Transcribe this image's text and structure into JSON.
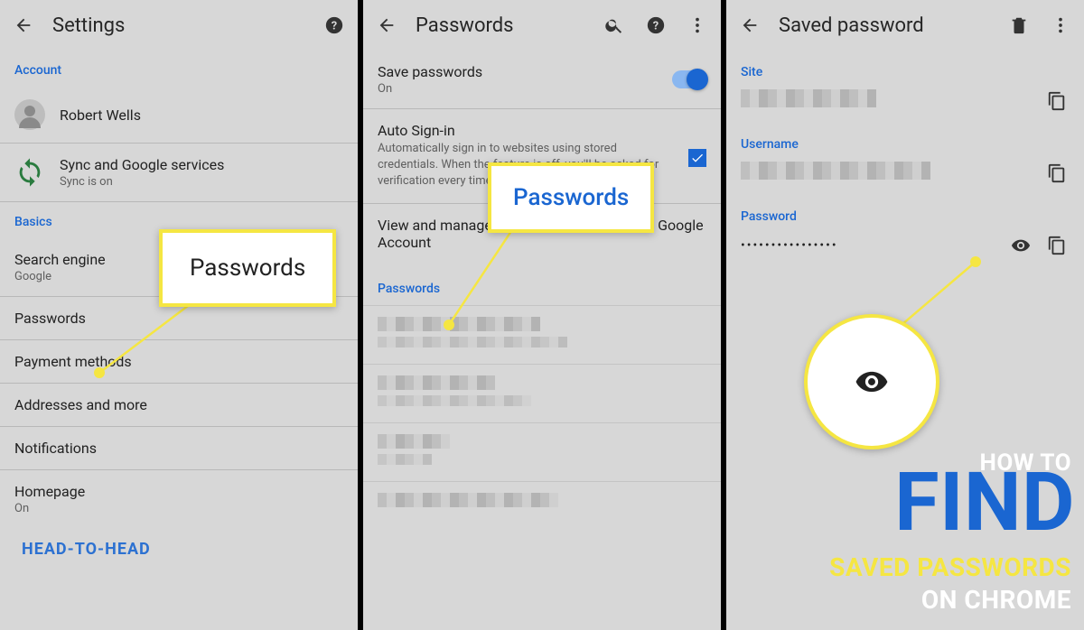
{
  "panel1": {
    "title": "Settings",
    "account_label": "Account",
    "user_name": "Robert Wells",
    "sync_title": "Sync and Google services",
    "sync_sub": "Sync is on",
    "basics_label": "Basics",
    "search_engine": "Search engine",
    "search_engine_value": "Google",
    "passwords": "Passwords",
    "payment": "Payment methods",
    "addresses": "Addresses and more",
    "notifications": "Notifications",
    "homepage": "Homepage",
    "homepage_value": "On"
  },
  "panel2": {
    "title": "Passwords",
    "save_passwords": "Save passwords",
    "save_passwords_state": "On",
    "auto_signin": "Auto Sign-in",
    "auto_signin_desc": "Automatically sign in to websites using stored credentials. When the feature is off, you'll be asked for verification every time before signing in to a website.",
    "view_manage": "View and manage saved passwords in your ",
    "google_account": "Google Account",
    "passwords_section": "Passwords"
  },
  "panel3": {
    "title": "Saved password",
    "site_label": "Site",
    "username_label": "Username",
    "password_label": "Password",
    "password_masked": "••••••••••••••••"
  },
  "callouts": {
    "passwords_big": "Passwords",
    "passwords_blue": "Passwords"
  },
  "overlay": {
    "howto": "HOW TO",
    "find": "FIND",
    "saved_passwords": "SAVED PASSWORDS",
    "on_chrome": "ON CHROME",
    "watermark": "HEAD-TO-HEAD"
  }
}
